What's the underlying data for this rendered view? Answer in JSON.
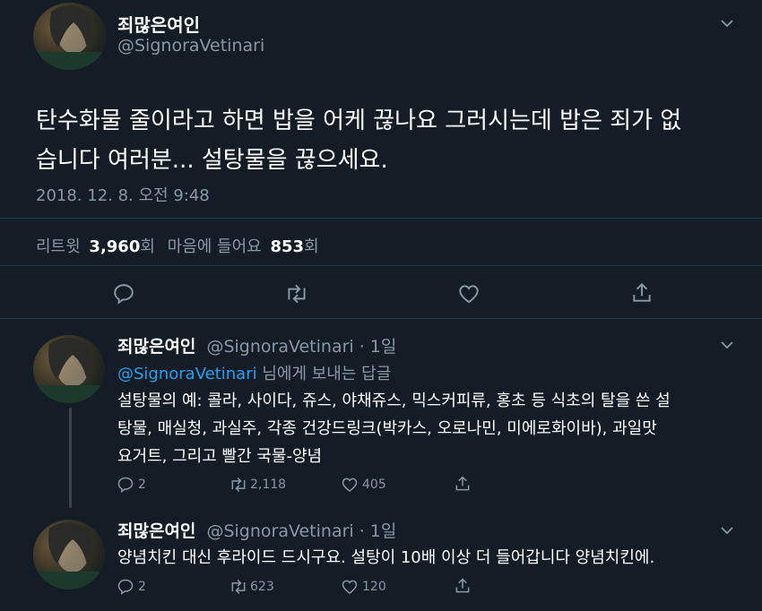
{
  "main_tweet": {
    "display_name": "죄많은여인",
    "handle": "@SignoraVetinari",
    "text_line1": "탄수화물 줄이라고 하면 밥을 어케 끊나요 그러시는데 밥은 죄가 없",
    "text_line2": "습니다 여러분... 설탕물을 끊으세요.",
    "timestamp": "2018. 12. 8. 오전 9:48",
    "retweets_label": "리트윗",
    "retweets_count": "3,960",
    "retweets_unit": "회",
    "likes_label": "마음에 들어요",
    "likes_count": "853",
    "likes_unit": "회"
  },
  "replies": [
    {
      "display_name": "죄많은여인",
      "handle_time": "@SignoraVetinari · 1일",
      "reply_to_handle": "@SignoraVetinari",
      "reply_to_suffix": "님에게 보내는 답글",
      "text_line1": "설탕물의 예: 콜라, 사이다, 쥬스, 야채쥬스, 믹스커피류, 홍초 등 식초의 탈을 쓴 설",
      "text_line2": "탕물, 매실청, 과실주, 각종 건강드링크(박카스, 오로나민, 미에로화이바), 과일맛",
      "text_line3": "요거트, 그리고 빨간 국물-양념",
      "replies_count": "2",
      "retweets_count": "2,118",
      "likes_count": "405"
    },
    {
      "display_name": "죄많은여인",
      "handle_time": "@SignoraVetinari · 1일",
      "text_line1": "양념치킨 대신 후라이드 드시구요. 설탕이 10배 이상 더 들어갑니다 양념치킨에.",
      "replies_count": "2",
      "retweets_count": "623",
      "likes_count": "120"
    }
  ],
  "icons": {
    "avatar": "avatar-image",
    "more": "chevron-down-icon",
    "reply": "reply-icon",
    "retweet": "retweet-icon",
    "like": "heart-icon",
    "share": "share-icon"
  },
  "colors": {
    "background": "#141d26",
    "text": "#ffffff",
    "muted": "#8899a6",
    "link": "#1da1f2",
    "divider": "#243447"
  }
}
